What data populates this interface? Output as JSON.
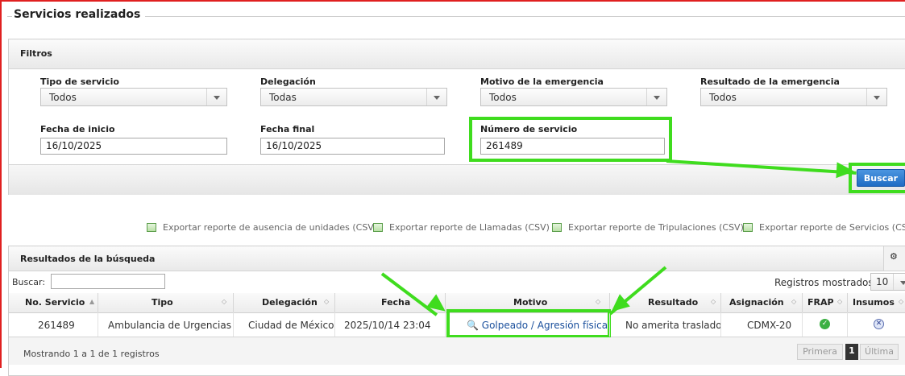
{
  "page": {
    "title": "Servicios realizados"
  },
  "filters": {
    "heading": "Filtros",
    "tipo_servicio": {
      "label": "Tipo de servicio",
      "value": "Todos"
    },
    "delegacion": {
      "label": "Delegación",
      "value": "Todas"
    },
    "motivo": {
      "label": "Motivo de la emergencia",
      "value": "Todos"
    },
    "resultado": {
      "label": "Resultado de la emergencia",
      "value": "Todos"
    },
    "fecha_inicio": {
      "label": "Fecha de inicio",
      "value": "16/10/2025"
    },
    "fecha_final": {
      "label": "Fecha final",
      "value": "16/10/2025"
    },
    "numero_servicio": {
      "label": "Número de servicio",
      "value": "261489"
    },
    "search_button": "Buscar"
  },
  "exports": [
    "Exportar reporte de ausencia de unidades (CSV)",
    "Exportar reporte de Llamadas (CSV)",
    "Exportar reporte de Tripulaciones (CSV)",
    "Exportar reporte de Servicios (CSV)"
  ],
  "results": {
    "heading": "Resultados de la búsqueda",
    "search_label": "Buscar:",
    "search_value": "",
    "records_label": "Registros mostrados:",
    "records_value": "10",
    "columns": [
      "No. Servicio",
      "Tipo",
      "Delegación",
      "Fecha",
      "Motivo",
      "Resultado",
      "Asignación",
      "FRAP",
      "Insumos"
    ],
    "rows": [
      {
        "no_servicio": "261489",
        "tipo": "Ambulancia de Urgencias",
        "delegacion": "Ciudad de México",
        "fecha": "2025/10/14 23:04",
        "motivo": "Golpeado / Agresión física",
        "resultado": "No amerita traslado",
        "asignacion": "CDMX-20",
        "frap": "check-icon",
        "insumos": "close-circle-icon"
      }
    ],
    "summary": "Mostrando 1 a 1 de 1 registros",
    "pagination": {
      "first": "Primera",
      "current": "1",
      "last": "Última"
    }
  },
  "colors": {
    "highlight": "#3fdc1e",
    "button": "#2a7bd0",
    "link": "#1a4f9c",
    "frame": "#e02020"
  }
}
